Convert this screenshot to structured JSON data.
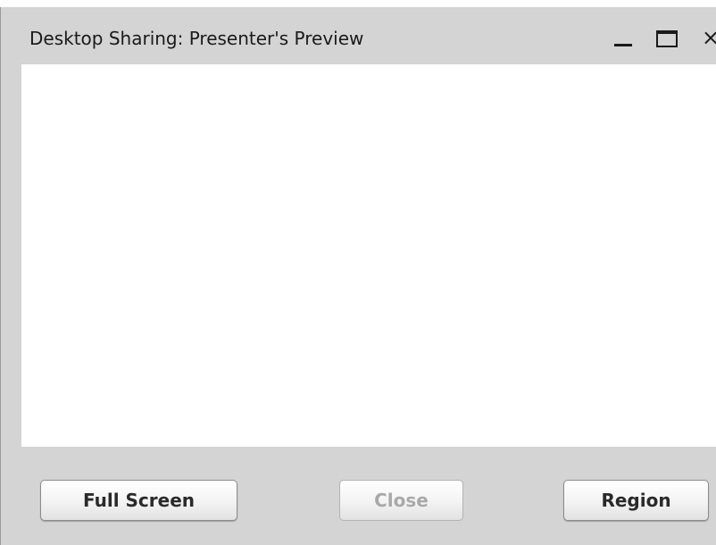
{
  "window": {
    "title": "Desktop Sharing: Presenter's Preview",
    "controls": {
      "minimize_icon": "minimize-icon",
      "maximize_icon": "maximize-icon",
      "close_glyph": "×"
    }
  },
  "buttons": {
    "full_screen": "Full Screen",
    "close": "Close",
    "region": "Region"
  },
  "state": {
    "close_enabled": false
  },
  "colors": {
    "chrome": "#d4d4d4",
    "preview_background": "#ffffff",
    "disabled_text": "#a9a9a9"
  }
}
